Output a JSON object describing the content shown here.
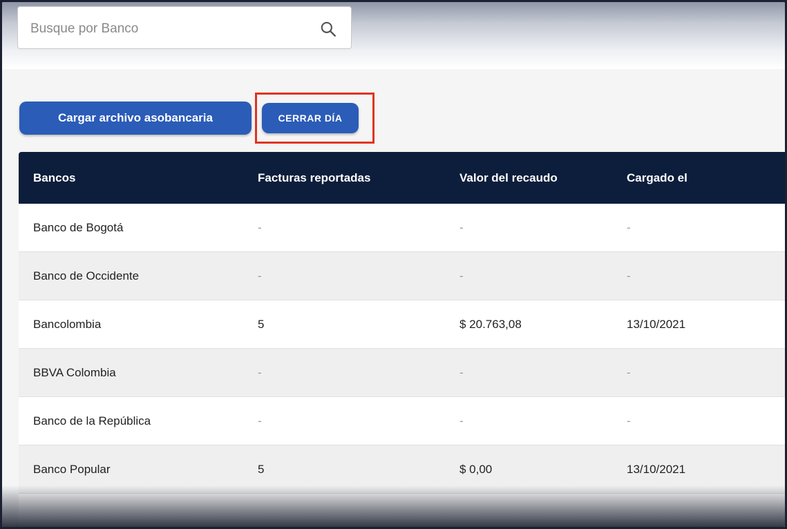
{
  "search": {
    "placeholder": "Busque por Banco",
    "value": ""
  },
  "actions": {
    "upload_label": "Cargar archivo asobancaria",
    "close_day_label": "CERRAR DÍA"
  },
  "table": {
    "headers": [
      "Bancos",
      "Facturas reportadas",
      "Valor del recaudo",
      "Cargado el"
    ],
    "rows": [
      [
        "Banco de Bogotá",
        "-",
        "-",
        "-"
      ],
      [
        "Banco de Occidente",
        "-",
        "-",
        "-"
      ],
      [
        "Bancolombia",
        "5",
        "$ 20.763,08",
        "13/10/2021"
      ],
      [
        "BBVA Colombia",
        "-",
        "-",
        "-"
      ],
      [
        "Banco de la República",
        "-",
        "-",
        "-"
      ],
      [
        "Banco Popular",
        "5",
        "$ 0,00",
        "13/10/2021"
      ]
    ]
  },
  "colors": {
    "primary": "#2b5cb8",
    "header_bg": "#0c1e3b",
    "highlight": "#e0341f"
  }
}
